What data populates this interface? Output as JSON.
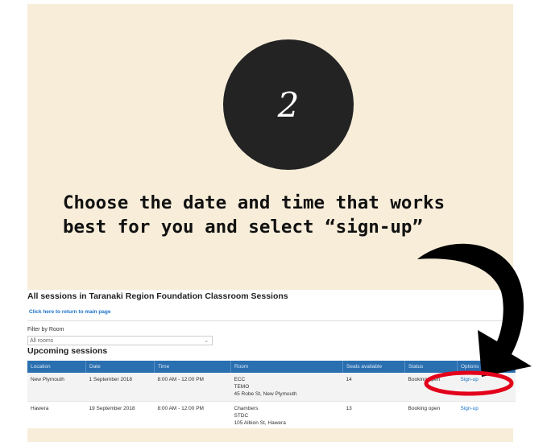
{
  "step": {
    "number": "2"
  },
  "instruction": {
    "line1": "Choose the date and time that works",
    "line2": "best for you and select “sign-up”"
  },
  "screenshot": {
    "title": "All sessions in Taranaki Region Foundation Classroom Sessions",
    "return_link": "Click here to return to main page",
    "filter_label": "Filter by Room",
    "filter_value": "All rooms",
    "section_heading": "Upcoming sessions",
    "columns": [
      "Location",
      "Date",
      "Time",
      "Room",
      "Seats available",
      "Status",
      "Options"
    ],
    "rows": [
      {
        "location": "New Plymouth",
        "date": "1 September 2018",
        "time": "8:00 AM - 12:00 PM",
        "room": [
          "ECC",
          "TEMO",
          "45 Robe St, New Plymouth"
        ],
        "seats": "14",
        "status": "Booking open",
        "option": "Sign-up"
      },
      {
        "location": "Hawera",
        "date": "19 September 2018",
        "time": "8:00 AM - 12:00 PM",
        "room": [
          "Chambers",
          "STDC",
          "105 Albion St, Hawera"
        ],
        "seats": "13",
        "status": "Booking open",
        "option": "Sign-up"
      }
    ]
  },
  "colors": {
    "panel_bg": "#f7edd9",
    "circle": "#232323",
    "table_header": "#2a6fb0",
    "link": "#1a73c8",
    "highlight_ring": "#e3001b",
    "arrow": "#000000"
  },
  "icons": [
    "chevron-down-icon",
    "curved-arrow-icon",
    "highlight-ellipse"
  ]
}
